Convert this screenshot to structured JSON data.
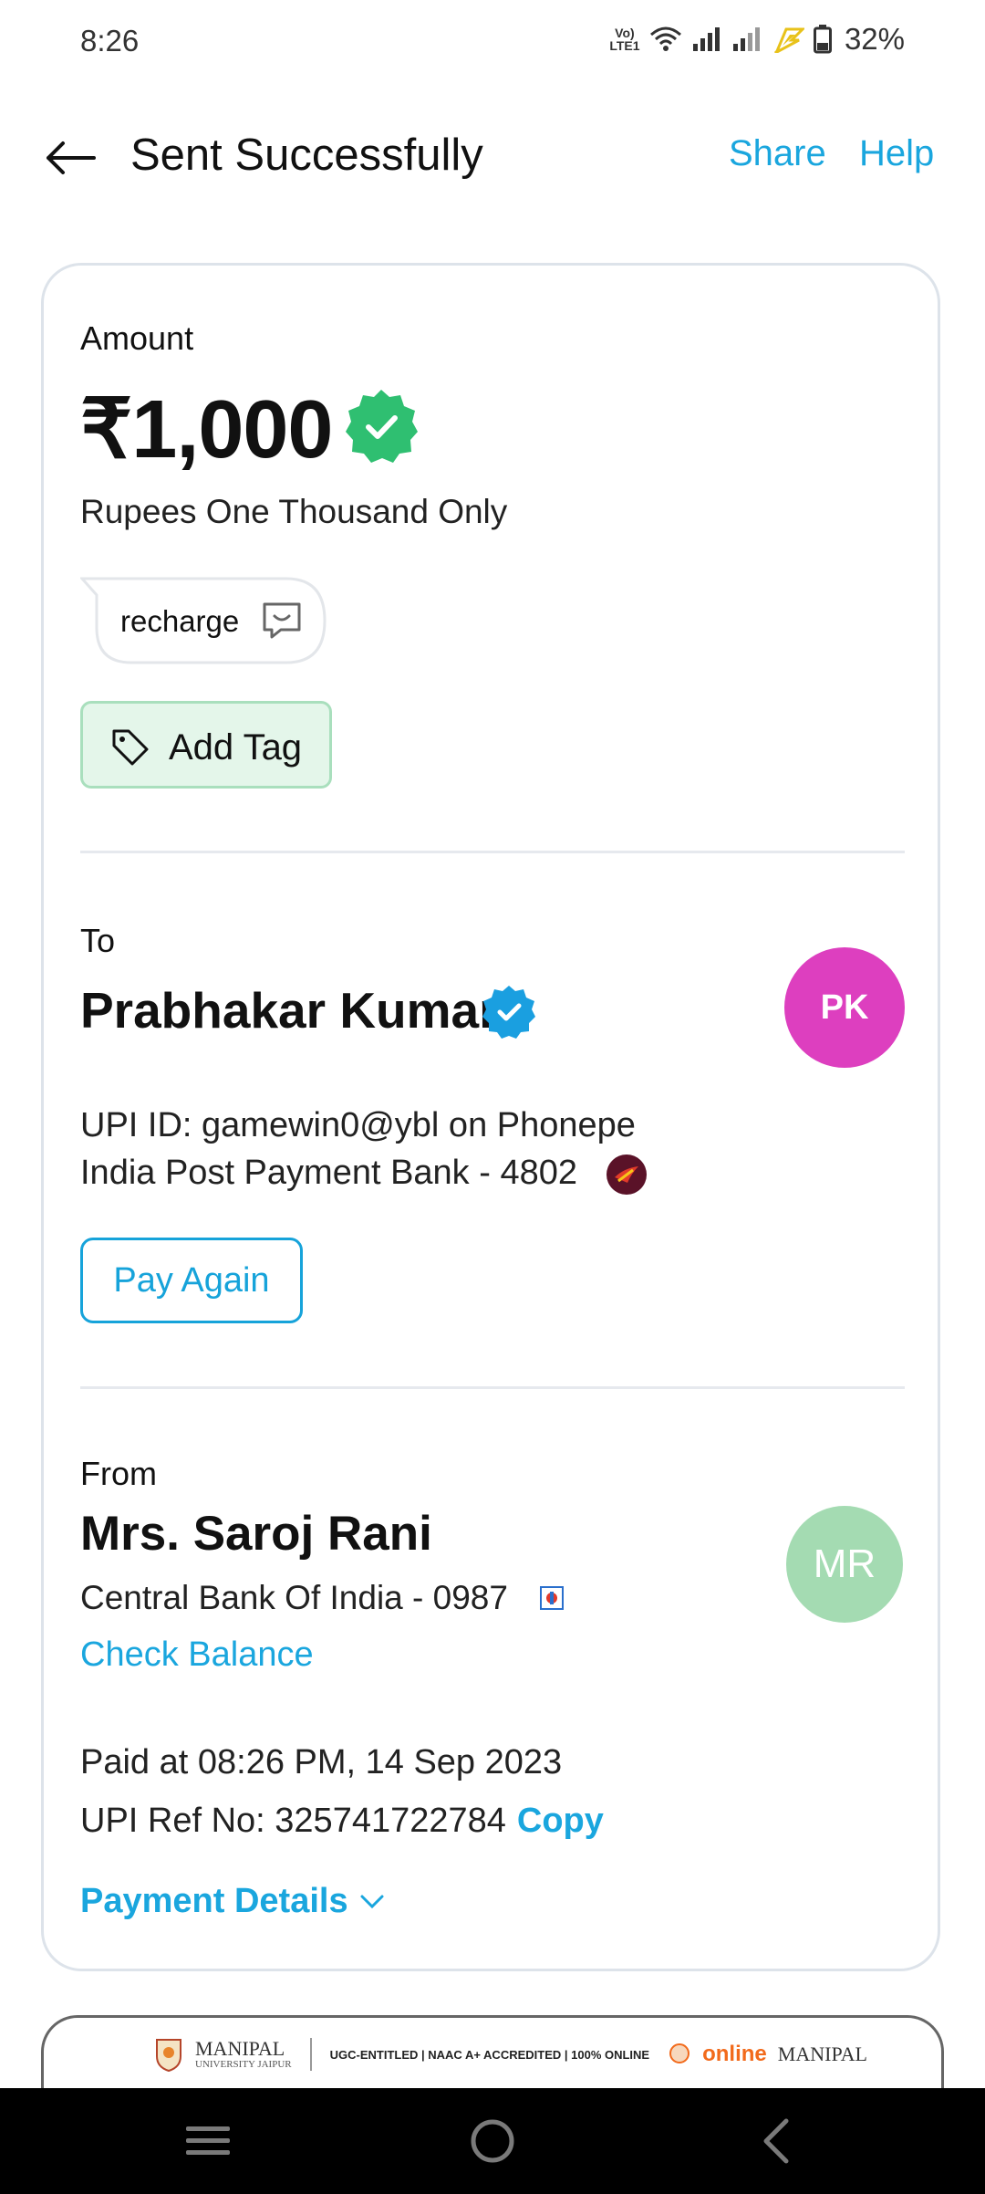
{
  "status_bar": {
    "time": "8:26",
    "network_label": "Vo) LTE1",
    "battery": "32%"
  },
  "header": {
    "title": "Sent Successfully",
    "share": "Share",
    "help": "Help"
  },
  "amount": {
    "label": "Amount",
    "value": "₹1,000",
    "words": "Rupees One Thousand Only",
    "note": "recharge",
    "add_tag": "Add Tag",
    "success_color": "#2fbf71"
  },
  "to": {
    "label": "To",
    "name": "Prabhakar Kumar",
    "initials": "PK",
    "avatar_color": "#dd3fbf",
    "upi_id": "UPI ID: gamewin0@ybl on Phonepe",
    "bank": "India Post Payment Bank - 4802",
    "pay_again": "Pay Again"
  },
  "from": {
    "label": "From",
    "name": "Mrs. Saroj Rani",
    "initials": "MR",
    "avatar_color": "#a4dbb2",
    "bank": "Central Bank Of India - 0987",
    "check_balance": "Check Balance"
  },
  "details": {
    "paid_at": "Paid at 08:26 PM, 14 Sep 2023",
    "ref_label": "UPI Ref No: 325741722784",
    "copy": "Copy",
    "payment_details": "Payment Details"
  },
  "ad": {
    "logo": "MANIPAL",
    "logo_sub": "UNIVERSITY JAIPUR",
    "tagline": "UGC-ENTITLED | NAAC A+ ACCREDITED | 100% ONLINE",
    "online": "online",
    "manipal": "MANIPAL"
  },
  "icons": {
    "back": "arrow-left-icon",
    "verified": "verified-badge-icon",
    "note": "message-icon",
    "tag": "tag-icon",
    "chevron": "chevron-down-icon",
    "nav": [
      "menu-icon",
      "home-icon",
      "back-icon"
    ]
  },
  "accent_color": "#1aa6de"
}
